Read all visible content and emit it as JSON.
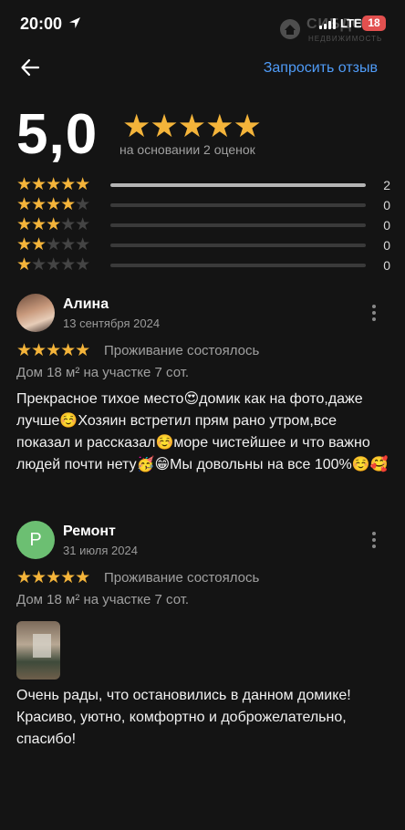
{
  "status_bar": {
    "time": "20:00",
    "network": "LTE",
    "battery": "18"
  },
  "watermark": {
    "brand": "СИБДОМ",
    "subtitle": "НЕДВИЖИМОСТЬ"
  },
  "header": {
    "request_review_label": "Запросить отзыв"
  },
  "summary": {
    "rating": "5,0",
    "stars": "★★★★★",
    "caption": "на основании 2 оценок",
    "breakdown": [
      {
        "stars": 5,
        "count": "2",
        "fraction": 1.0
      },
      {
        "stars": 4,
        "count": "0",
        "fraction": 0
      },
      {
        "stars": 3,
        "count": "0",
        "fraction": 0
      },
      {
        "stars": 2,
        "count": "0",
        "fraction": 0
      },
      {
        "stars": 1,
        "count": "0",
        "fraction": 0
      }
    ]
  },
  "reviews": [
    {
      "name": "Алина",
      "date": "13 сентября 2024",
      "stars": "★★★★★",
      "status": "Проживание состоялось",
      "meta": "Дом 18 м² на участке 7 сот.",
      "text": "Прекрасное тихое место😍домик как на фото,даже лучше☺️Хозяин встретил прям рано утром,все показал и рассказал☺️море чистейшее и что важно людей почти нету🥳😁Мы довольны на все 100%☺️🥰"
    },
    {
      "name": "Ремонт",
      "avatar_letter": "Р",
      "date": "31 июля 2024",
      "stars": "★★★★★",
      "status": "Проживание состоялось",
      "meta": "Дом 18 м² на участке 7 сот.",
      "text": "Очень рады, что остановились в данном домике! Красиво, уютно, комфортно и доброжелательно, спасибо!"
    }
  ],
  "colors": {
    "star": "#f4b43a",
    "link": "#4f9bf7",
    "background": "#141414",
    "avatar_green": "#6cbf72",
    "battery": "#e2504f"
  },
  "icons": [
    "location-arrow-icon",
    "signal-icon",
    "back-arrow-icon",
    "star-icon",
    "more-vertical-icon"
  ]
}
